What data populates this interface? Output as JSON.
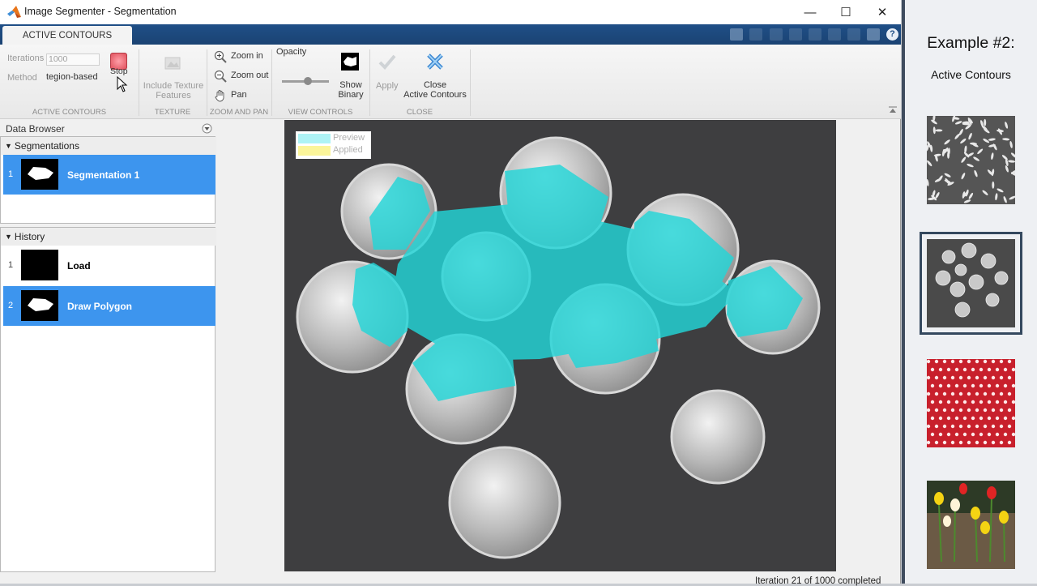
{
  "window": {
    "title": "Image Segmenter - Segmentation",
    "minimize": "—",
    "maximize": "☐",
    "close": "✕"
  },
  "tab": {
    "label": "ACTIVE CONTOURS"
  },
  "ribbon": {
    "iterations_label": "Iterations",
    "iterations_value": "1000",
    "method_label": "Method",
    "method_value": "Region-based",
    "method_display": "tegion-based",
    "stop_label": "Stop",
    "texture_label_1": "Include Texture",
    "texture_label_2": "Features",
    "zoom_in": "Zoom in",
    "zoom_out": "Zoom out",
    "pan": "Pan",
    "opacity_label": "Opacity",
    "opacity_value": 0.55,
    "show_binary_1": "Show",
    "show_binary_2": "Binary",
    "apply": "Apply",
    "close_ac_1": "Close",
    "close_ac_2": "Active Contours",
    "groups": {
      "active_contours": "ACTIVE CONTOURS",
      "texture": "TEXTURE",
      "zoom_pan": "ZOOM AND PAN",
      "view_controls": "VIEW CONTROLS",
      "close": "CLOSE"
    }
  },
  "data_browser": {
    "title": "Data Browser",
    "segmentations_header": "Segmentations",
    "segmentations": [
      {
        "num": "1",
        "label": "Segmentation 1",
        "selected": true
      }
    ],
    "history_header": "History",
    "history": [
      {
        "num": "1",
        "label": "Load",
        "selected": false
      },
      {
        "num": "2",
        "label": "Draw Polygon",
        "selected": true
      }
    ]
  },
  "legend": {
    "preview": "Preview",
    "applied": "Applied",
    "preview_color": "#aef3f5",
    "applied_color": "#fbf59a"
  },
  "status": {
    "text": "Iteration 21 of 1000 completed"
  },
  "sidebar": {
    "heading": "Example #2:",
    "subheading": "Active Contours",
    "thumbnails": [
      {
        "name": "rice",
        "active": false
      },
      {
        "name": "coins",
        "active": true
      },
      {
        "name": "polka-dots",
        "active": false
      },
      {
        "name": "tulips",
        "active": false
      }
    ]
  },
  "colors": {
    "overlay": "#23d6d8",
    "selection": "#3d95ee",
    "titlebar_strip": "#1f4f87"
  }
}
